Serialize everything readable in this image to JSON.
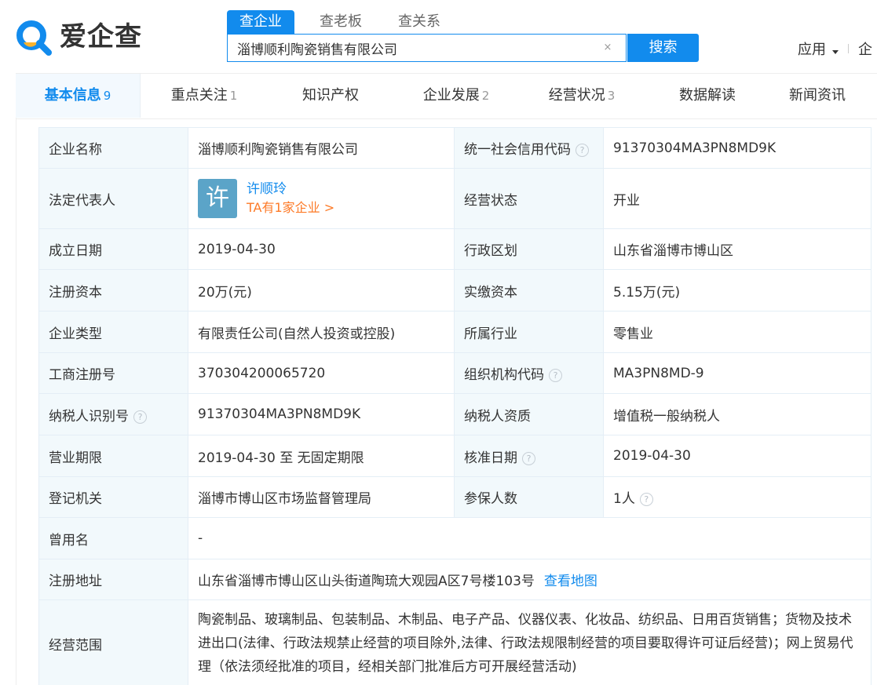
{
  "header": {
    "logo_text": "爱企查",
    "search_tabs": [
      "查企业",
      "查老板",
      "查关系"
    ],
    "search_value": "淄博顺利陶瓷销售有限公司",
    "clear_symbol": "×",
    "search_button": "搜索",
    "apps_label": "应用",
    "right_partial": "企"
  },
  "nav_tabs": [
    {
      "label": "基本信息",
      "count": "9"
    },
    {
      "label": "重点关注",
      "count": "1"
    },
    {
      "label": "知识产权",
      "count": ""
    },
    {
      "label": "企业发展",
      "count": "2"
    },
    {
      "label": "经营状况",
      "count": "3"
    },
    {
      "label": "数据解读",
      "count": ""
    },
    {
      "label": "新闻资讯",
      "count": ""
    }
  ],
  "info": {
    "company_name": {
      "label": "企业名称",
      "value": "淄博顺利陶瓷销售有限公司"
    },
    "credit_code": {
      "label": "统一社会信用代码",
      "value": "91370304MA3PN8MD9K"
    },
    "legal_rep": {
      "label": "法定代表人",
      "avatar_char": "许",
      "name": "许顺玲",
      "link": "TA有1家企业 >"
    },
    "status": {
      "label": "经营状态",
      "value": "开业"
    },
    "established": {
      "label": "成立日期",
      "value": "2019-04-30"
    },
    "region": {
      "label": "行政区划",
      "value": "山东省淄博市博山区"
    },
    "reg_capital": {
      "label": "注册资本",
      "value": "20万(元)"
    },
    "paid_capital": {
      "label": "实缴资本",
      "value": "5.15万(元)"
    },
    "company_type": {
      "label": "企业类型",
      "value": "有限责任公司(自然人投资或控股)"
    },
    "industry": {
      "label": "所属行业",
      "value": "零售业"
    },
    "reg_number": {
      "label": "工商注册号",
      "value": "370304200065720"
    },
    "org_code": {
      "label": "组织机构代码",
      "value": "MA3PN8MD-9"
    },
    "taxpayer_id": {
      "label": "纳税人识别号",
      "value": "91370304MA3PN8MD9K"
    },
    "taxpayer_type": {
      "label": "纳税人资质",
      "value": "增值税一般纳税人"
    },
    "business_term": {
      "label": "营业期限",
      "value": "2019-04-30 至 无固定期限"
    },
    "approval_date": {
      "label": "核准日期",
      "value": "2019-04-30"
    },
    "authority": {
      "label": "登记机关",
      "value": "淄博市博山区市场监督管理局"
    },
    "insured": {
      "label": "参保人数",
      "value": "1人"
    },
    "former_name": {
      "label": "曾用名",
      "value": "-"
    },
    "address": {
      "label": "注册地址",
      "value": "山东省淄博市博山区山头街道陶琉大观园A区7号楼103号",
      "map_link": "查看地图"
    },
    "scope": {
      "label": "经营范围",
      "value": "陶瓷制品、玻璃制品、包装制品、木制品、电子产品、仪器仪表、化妆品、纺织品、日用百货销售；货物及技术进出口(法律、行政法规禁止经营的项目除外,法律、行政法规限制经营的项目要取得许可证后经营)；网上贸易代理（依法须经批准的项目，经相关部门批准后方可开展经营活动)"
    }
  },
  "help_symbol": "?",
  "colors": {
    "brand_blue": "#128bed",
    "orange_link": "#fd7a27",
    "label_bg": "#f2f9fc",
    "avatar_bg": "#5ba4c8"
  }
}
